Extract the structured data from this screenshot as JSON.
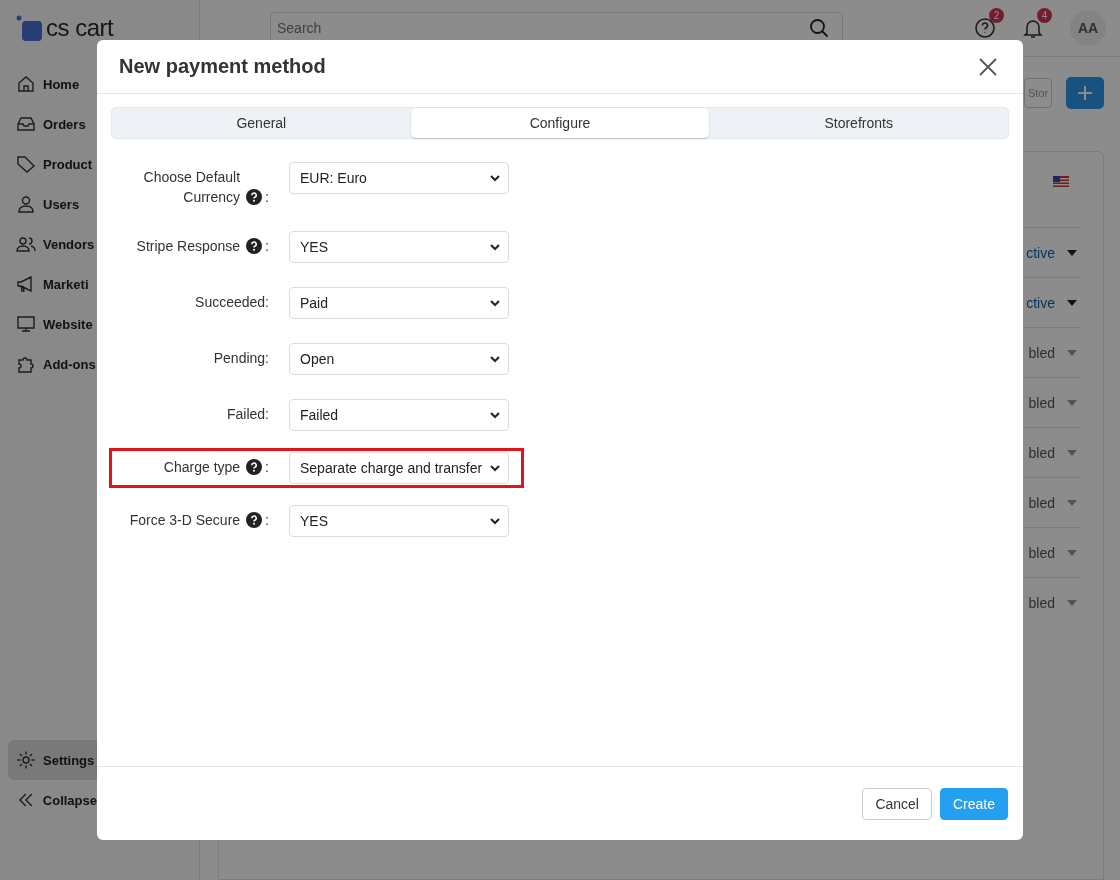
{
  "app": {
    "logo_text": "cs cart",
    "search": {
      "placeholder": "Search"
    },
    "help_badge": "2",
    "notifications_badge": "4",
    "avatar": "AA",
    "sidebar": [
      {
        "label": "Home",
        "selected": false
      },
      {
        "label": "Orders",
        "selected": false
      },
      {
        "label": "Product",
        "selected": false
      },
      {
        "label": "Users",
        "selected": false
      },
      {
        "label": "Vendors",
        "selected": false
      },
      {
        "label": "Marketi",
        "selected": false
      },
      {
        "label": "Website",
        "selected": false
      },
      {
        "label": "Add-ons",
        "selected": false
      }
    ],
    "sidebar_bottom": [
      {
        "label": "Settings",
        "selected": true
      },
      {
        "label": "Collapse",
        "selected": false
      }
    ],
    "storefront_button": "Stor",
    "status_rows": [
      {
        "status": "ctive",
        "kind": "active"
      },
      {
        "status": "ctive",
        "kind": "active"
      },
      {
        "status": "bled",
        "kind": "disabled"
      },
      {
        "status": "bled",
        "kind": "disabled"
      },
      {
        "status": "bled",
        "kind": "disabled"
      },
      {
        "status": "bled",
        "kind": "disabled"
      },
      {
        "status": "bled",
        "kind": "disabled"
      },
      {
        "status": "bled",
        "kind": "disabled"
      }
    ]
  },
  "modal": {
    "title": "New payment method",
    "tabs": [
      {
        "label": "General",
        "selected": false
      },
      {
        "label": "Configure",
        "selected": true
      },
      {
        "label": "Storefronts",
        "selected": false
      }
    ],
    "fields": [
      {
        "label": "Choose Default Currency",
        "help": true,
        "suffix": ":",
        "value": "EUR: Euro",
        "highlighted": false
      },
      {
        "label": "Stripe Response",
        "help": true,
        "suffix": ":",
        "value": "YES",
        "highlighted": false
      },
      {
        "label": "Succeeded:",
        "help": false,
        "value": "Paid",
        "highlighted": false
      },
      {
        "label": "Pending:",
        "help": false,
        "value": "Open",
        "highlighted": false
      },
      {
        "label": "Failed:",
        "help": false,
        "value": "Failed",
        "highlighted": false
      },
      {
        "label": "Charge type",
        "help": true,
        "suffix": ":",
        "value": "Separate charge and transfer",
        "highlighted": true
      },
      {
        "label": "Force 3-D Secure",
        "help": true,
        "suffix": ":",
        "value": "YES",
        "highlighted": false
      }
    ],
    "buttons": [
      {
        "label": "Cancel",
        "kind": "secondary"
      },
      {
        "label": "Create",
        "kind": "primary"
      }
    ]
  }
}
